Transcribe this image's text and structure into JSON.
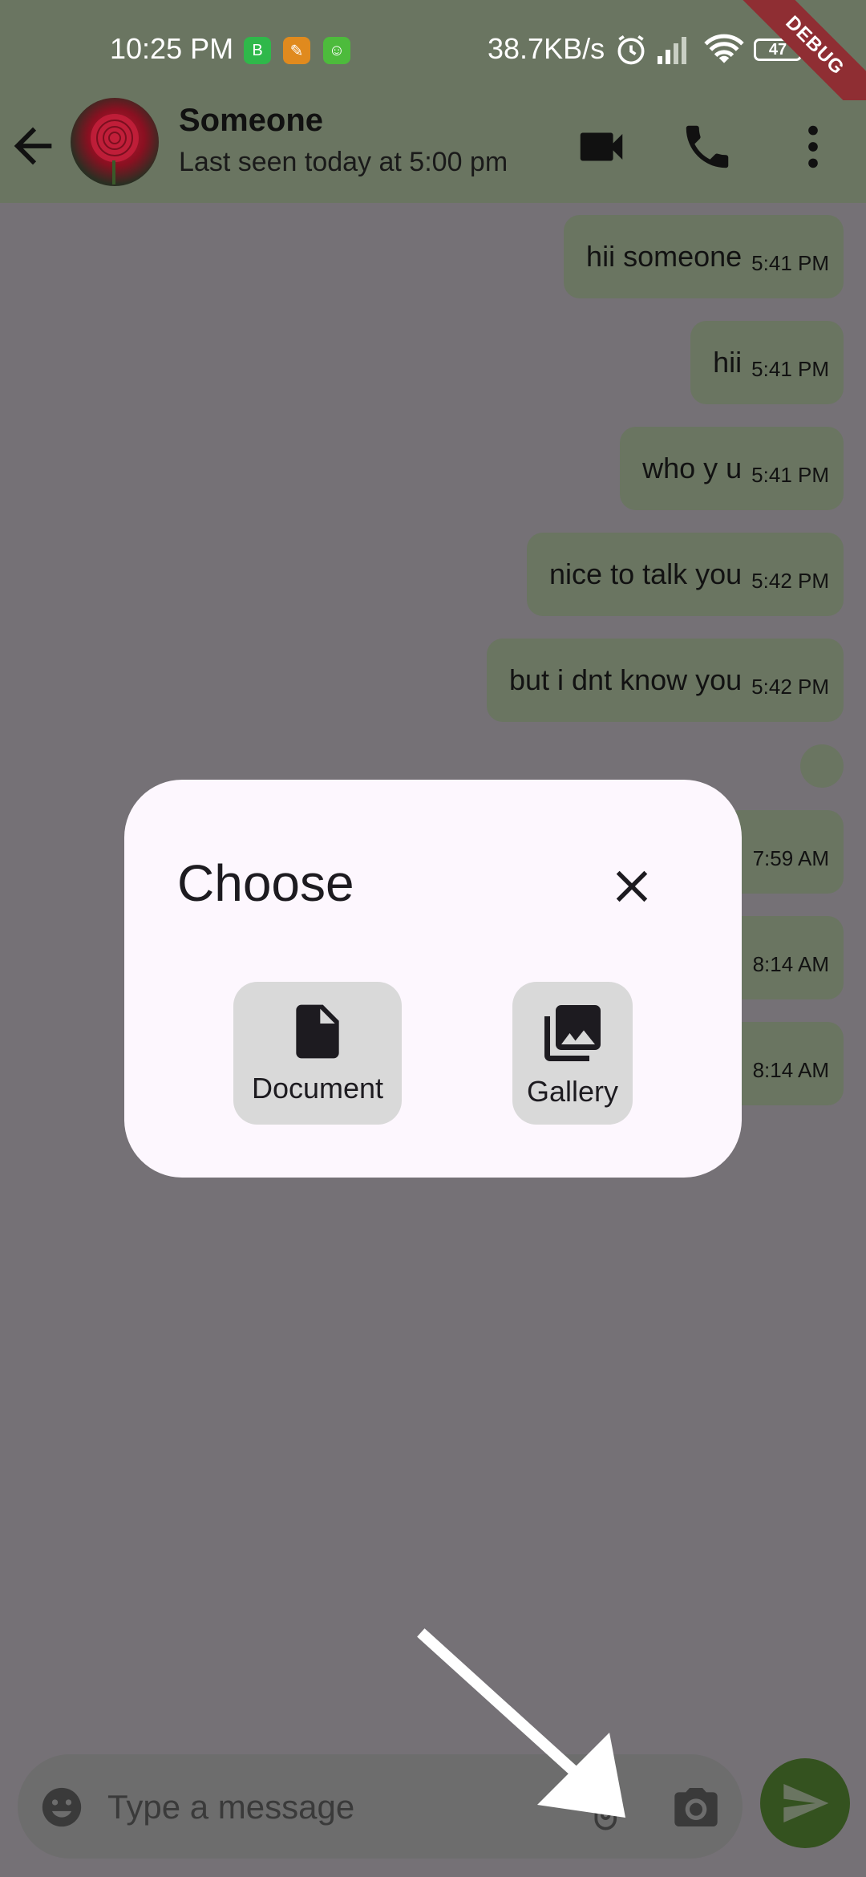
{
  "status_bar": {
    "time": "10:25 PM",
    "net_speed": "38.7KB/s",
    "battery": "47",
    "debug_label": "DEBUG"
  },
  "header": {
    "contact_name": "Someone",
    "last_seen": "Last seen today at 5:00 pm"
  },
  "messages": [
    {
      "text": "hii someone",
      "time": "5:41 PM"
    },
    {
      "text": "hii",
      "time": "5:41 PM"
    },
    {
      "text": "who y u",
      "time": "5:41 PM"
    },
    {
      "text": "nice to talk you",
      "time": "5:42 PM"
    },
    {
      "text": "but i dnt know you",
      "time": "5:42 PM"
    },
    {
      "text": "",
      "time": "7:59 AM"
    },
    {
      "text": "",
      "time": "8:14 AM"
    },
    {
      "text": "",
      "time": "8:14 AM"
    }
  ],
  "dialog": {
    "title": "Choose",
    "options": [
      {
        "label": "Document",
        "icon": "document-icon"
      },
      {
        "label": "Gallery",
        "icon": "gallery-icon"
      }
    ]
  },
  "input": {
    "placeholder": "Type a message",
    "value": ""
  }
}
